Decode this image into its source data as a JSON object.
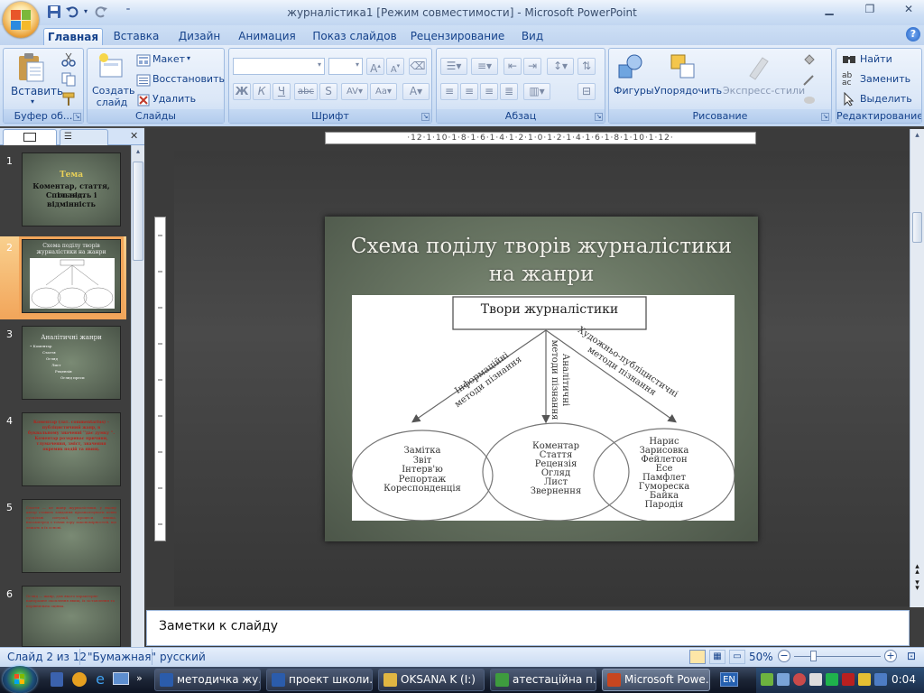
{
  "window": {
    "title": "журналістика1 [Режим совместимости] - Microsoft PowerPoint"
  },
  "ribbon": {
    "tabs": [
      {
        "label": "Главная",
        "active": true
      },
      {
        "label": "Вставка"
      },
      {
        "label": "Дизайн"
      },
      {
        "label": "Анимация"
      },
      {
        "label": "Показ слайдов"
      },
      {
        "label": "Рецензирование"
      },
      {
        "label": "Вид"
      }
    ],
    "clipboard": {
      "label": "Буфер об...",
      "paste": "Вставить"
    },
    "slides": {
      "label": "Слайды",
      "new_slide": "Создать\nслайд",
      "layout": "Макет",
      "reset": "Восстановить",
      "delete": "Удалить"
    },
    "font": {
      "label": "Шрифт"
    },
    "paragraph": {
      "label": "Абзац"
    },
    "drawing": {
      "label": "Рисование",
      "shapes": "Фигуры",
      "arrange": "Упорядочить",
      "quick_styles": "Экспресс-стили"
    },
    "editing": {
      "label": "Редактирование",
      "find": "Найти",
      "replace": "Заменить",
      "select": "Выделить"
    }
  },
  "ruler": {
    "horizontal": "·12·1·10·1·8·1·6·1·4·1·2·1·0·1·2·1·4·1·6·1·8·1·10·1·12·"
  },
  "thumbnails": [
    {
      "num": "1",
      "lines": [
        "Тема",
        "Коментар, стаття, огляд.",
        "Спільність і відмінність"
      ]
    },
    {
      "num": "2",
      "title": "Схема поділу творів журналістики на жанри",
      "selected": true
    },
    {
      "num": "3",
      "title": "Аналітичні жанри",
      "items": [
        "• Коментар",
        "Стаття",
        "Огляд",
        "Лист",
        "Рецензія",
        "Огляд преси"
      ]
    },
    {
      "num": "4",
      "text": "Коментар (лат. commentarius) – публіцистичний жанр, в буквальному значенні ''дає думку ''. Коментар розкриває причини, тлумачення, зміст, значення окремих подій та явищ."
    },
    {
      "num": "5",
      "text": "Стаття — це жанр журналістики, у якому автор ставить завдання проаналізувати певні суспільні ситуації, процеси, явища, насамперед з точки зору закономірностей, що лежать в їх основі."
    },
    {
      "num": "6",
      "text": "Огляд — жанр, для якого характерне панорамне охоплення явищ, їх зіставлення та порівняльна оцінка."
    }
  ],
  "slide": {
    "title": "Схема поділу творів журналістики  на жанри",
    "root": "Твори журналістики",
    "branches": [
      {
        "label_line1": "Інформаційні",
        "label_line2": "методи пізнання"
      },
      {
        "label_line1": "Аналітичні",
        "label_line2": "методи пізнання"
      },
      {
        "label_line1": "Художньо-публіцистичні",
        "label_line2": "методи пізнання"
      }
    ],
    "groups": [
      [
        "Замітка",
        "Звіт",
        "Інтерв'ю",
        "Репортаж",
        "Кореспонденція"
      ],
      [
        "Коментар",
        "Стаття",
        "Рецензія",
        "Огляд",
        "Лист",
        "Звернення"
      ],
      [
        "Нарис",
        "Зарисовка",
        "Фейлетон",
        "Есе",
        "Памфлет",
        "Гумореска",
        "Байка",
        "Пародія"
      ]
    ]
  },
  "notes": {
    "placeholder": "Заметки к слайду"
  },
  "status": {
    "slide_counter": "Слайд 2 из 12",
    "theme": "\"Бумажная\"",
    "language": "русский",
    "zoom": "50%"
  },
  "taskbar": {
    "items": [
      {
        "label": "методичка жу...",
        "color": "#2b5cab"
      },
      {
        "label": "проект школи...",
        "color": "#2b5cab"
      },
      {
        "label": "OKSANA K (I:)",
        "color": "#e0b642"
      },
      {
        "label": "атестаційна п...",
        "color": "#3e9b3e"
      },
      {
        "label": "Microsoft Powe...",
        "color": "#c8461f",
        "active": true
      }
    ],
    "lang": "EN",
    "clock": "0:04"
  }
}
